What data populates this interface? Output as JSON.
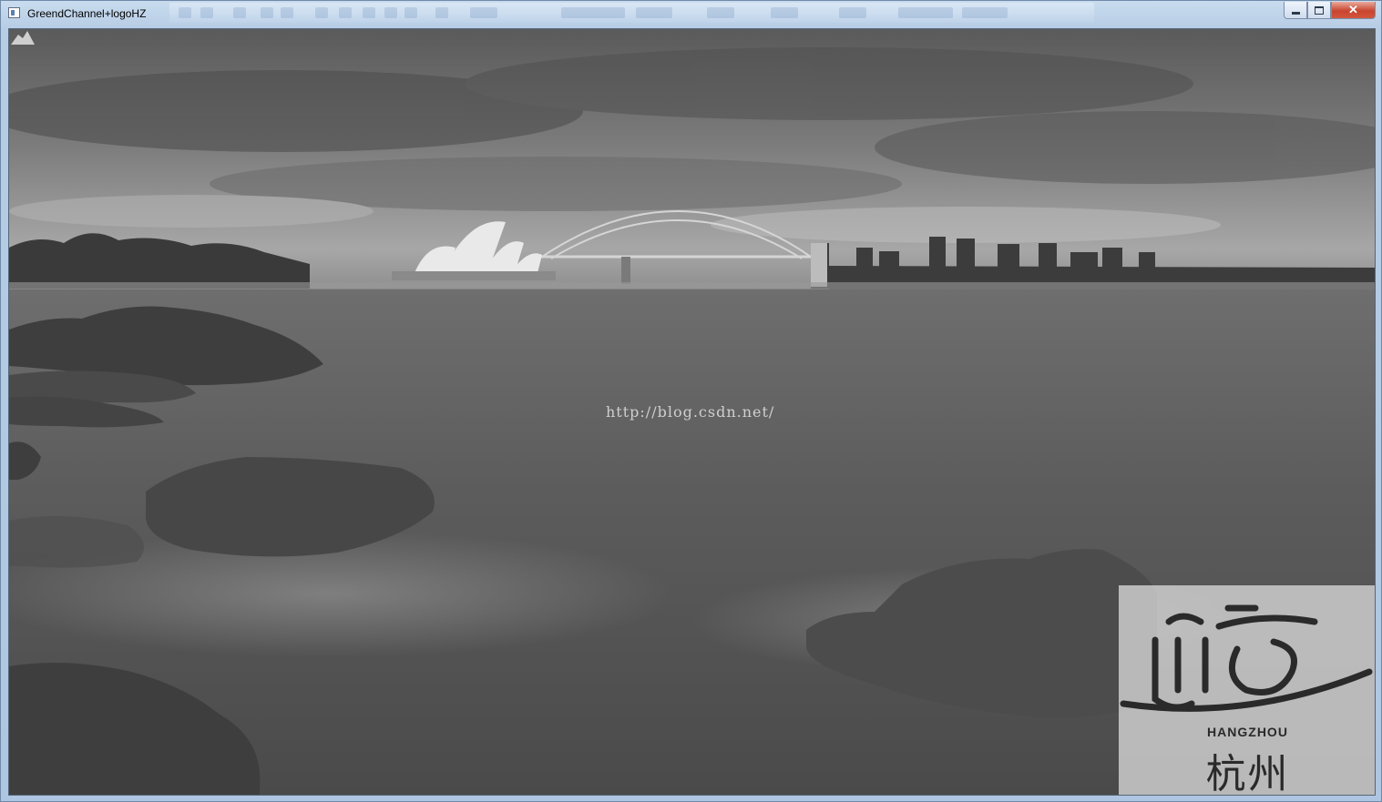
{
  "window": {
    "title": "GreendChannel+logoHZ",
    "controls": {
      "minimize": "minimize",
      "maximize": "maximize",
      "close": "✕"
    }
  },
  "image": {
    "watermark_text": "http://blog.csdn.net/",
    "logo": {
      "text_en": "HANGZHOU",
      "text_cn": "杭州"
    },
    "colors": {
      "sky": "#8a8a8a",
      "water": "#5f5f5f",
      "rock": "#3e3e3e"
    }
  }
}
